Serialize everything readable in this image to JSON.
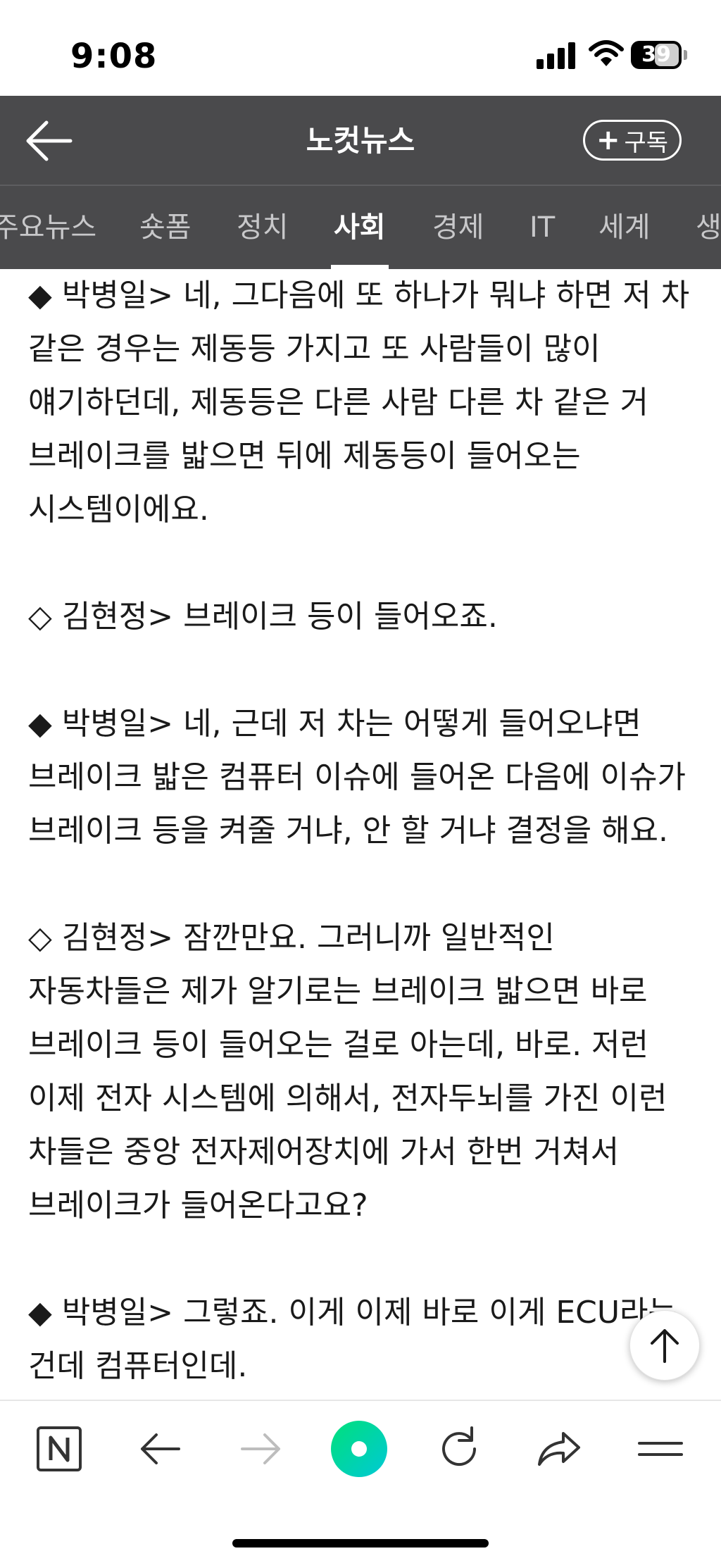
{
  "status_bar": {
    "time": "9:08",
    "battery_level": "39"
  },
  "header": {
    "title": "노컷뉴스",
    "subscribe_label": "구독"
  },
  "tabs": [
    {
      "label": "주요뉴스",
      "active": false
    },
    {
      "label": "숏폼",
      "active": false
    },
    {
      "label": "정치",
      "active": false
    },
    {
      "label": "사회",
      "active": true
    },
    {
      "label": "경제",
      "active": false
    },
    {
      "label": "IT",
      "active": false
    },
    {
      "label": "세계",
      "active": false
    },
    {
      "label": "생",
      "active": false
    }
  ],
  "article": {
    "paragraphs": [
      "◆ 박병일> 네, 그다음에 또 하나가 뭐냐 하면 저 차 같은 경우는 제동등 가지고 또 사람들이 많이 얘기하던데, 제동등은 다른 사람 다른 차 같은 거 브레이크를 밟으면 뒤에 제동등이 들어오는 시스템이에요.",
      "◇ 김현정> 브레이크 등이 들어오죠.",
      "◆ 박병일> 네, 근데 저 차는 어떻게 들어오냐면 브레이크 밟은 컴퓨터 이슈에 들어온 다음에 이슈가 브레이크 등을 켜줄 거냐, 안 할 거냐 결정을 해요.",
      "◇ 김현정> 잠깐만요. 그러니까 일반적인 자동차들은 제가 알기로는 브레이크 밟으면 바로 브레이크 등이 들어오는 걸로 아는데, 바로. 저런 이제 전자 시스템에 의해서, 전자두뇌를 가진 이런 차들은 중앙 전자제어장치에 가서 한번 거쳐서 브레이크가 들어온다고요?",
      "◆ 박병일> 그렇죠. 이게 이제 바로 이게 ECU라는 건데 컴퓨터인데."
    ]
  },
  "colors": {
    "header_bg": "#4a4a4c",
    "accent_green": "#00dc64",
    "text": "#1a1a1a"
  },
  "icons": {
    "back": "arrow-left-icon",
    "plus": "plus-icon",
    "scroll_top": "arrow-up-icon",
    "bottom": [
      "naver-logo-icon",
      "back-arrow-icon",
      "forward-arrow-icon",
      "green-dot-icon",
      "refresh-icon",
      "share-icon",
      "menu-icon"
    ]
  }
}
